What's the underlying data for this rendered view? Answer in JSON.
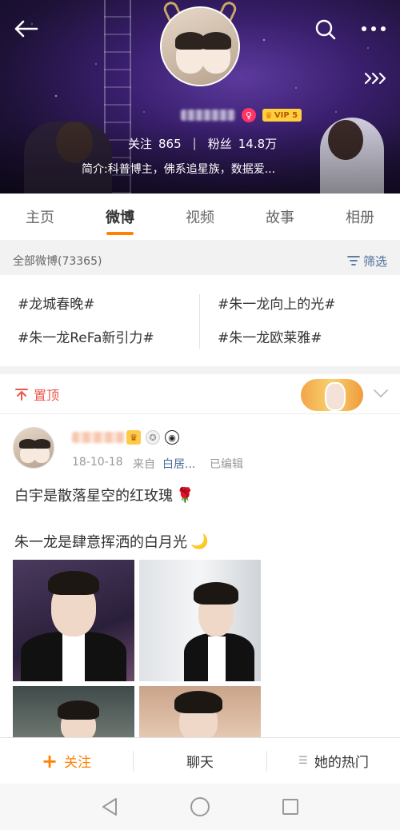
{
  "header": {
    "following_label": "关注",
    "following_count": "865",
    "followers_label": "粉丝",
    "followers_count": "14.8万",
    "bio": "简介:科普博主，佛系追星族，数据爱...",
    "vip_level": "VIP 5",
    "gender": "female"
  },
  "tabs": [
    "主页",
    "微博",
    "视频",
    "故事",
    "相册"
  ],
  "active_tab": "微博",
  "filter_bar": {
    "label": "全部微博(73365)",
    "filter_button": "筛选"
  },
  "topics": [
    "#龙城春晚#",
    "#朱一龙向上的光#",
    "#朱一龙ReFa新引力#",
    "#朱一龙欧莱雅#"
  ],
  "pinned": {
    "label": "置顶"
  },
  "post": {
    "date": "18-10-18",
    "source_prefix": "来自",
    "source": "白居...",
    "edited": "已编辑",
    "line1": "白宇是散落星空的红玫瑰",
    "line2": "朱一龙是肆意挥洒的白月光",
    "emoji1": "🌹",
    "emoji2": "🌙"
  },
  "bottom_bar": {
    "follow": "关注",
    "chat": "聊天",
    "hot": "她的热门"
  },
  "colors": {
    "accent": "#ff8200",
    "link": "#4a6e9a",
    "pin": "#e9574a"
  }
}
